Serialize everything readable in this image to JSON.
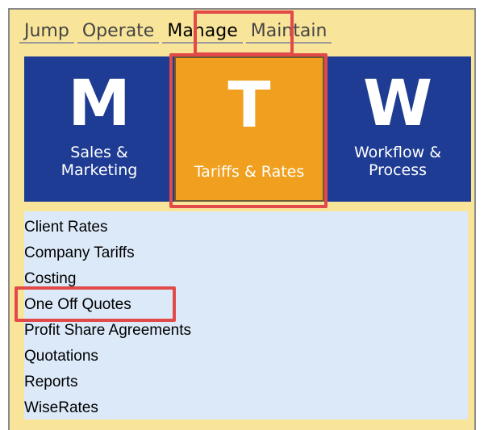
{
  "menu": {
    "items": [
      {
        "label": "Jump"
      },
      {
        "label": "Operate"
      },
      {
        "label": "Manage"
      },
      {
        "label": "Maintain"
      }
    ]
  },
  "tiles": [
    {
      "letter": "M",
      "caption_line1": "Sales &",
      "caption_line2": "Marketing",
      "color": "#1e3c93"
    },
    {
      "letter": "T",
      "caption_line1": "Tariffs & Rates",
      "caption_line2": "",
      "color": "#f0a01e"
    },
    {
      "letter": "W",
      "caption_line1": "Workflow &",
      "caption_line2": "Process",
      "color": "#1e3c93"
    }
  ],
  "list": {
    "items": [
      "Client Rates",
      "Company Tariffs",
      "Costing",
      "One Off Quotes",
      "Profit Share Agreements",
      "Quotations",
      "Reports",
      "WiseRates"
    ]
  },
  "colors": {
    "panel_background": "#f9e59a",
    "tile_blue": "#1e3c93",
    "tile_orange": "#f0a01e",
    "list_background": "#dce9f8",
    "highlight_red": "#e24a4a"
  }
}
